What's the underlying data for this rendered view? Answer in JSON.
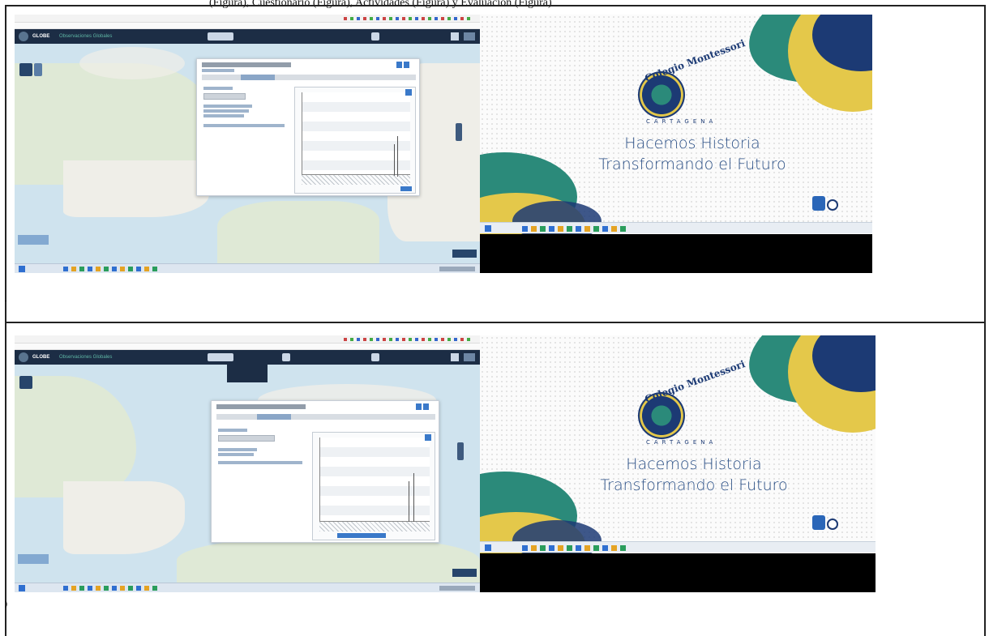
{
  "top_strip": {
    "text_1": "(Figura), Cuestionario (Figura), Actividades (Figura) y Evaluación (Figura)"
  },
  "app": {
    "name": "GLOBE",
    "tagline": "Observaciones Globales"
  },
  "slide": {
    "school_name": "Colegio Montessori",
    "city": "CARTAGENA",
    "line_1": "Hacemos Historia",
    "line_2": "Transformando el Futuro"
  },
  "row_markers": {
    "row_1": ".",
    "row_2": ")"
  },
  "icons": {
    "logo": "globe-logo-icon",
    "start": "windows-start-icon",
    "camera": "camera-icon",
    "speaker": "speaker-icon"
  },
  "colors": {
    "app_bar": "#1c2d45",
    "map_water": "#cfe3ee",
    "accent_blue": "#3a79c9",
    "slide_teal": "#2b8a7a",
    "slide_navy": "#1c3a74",
    "slide_yellow": "#e4c84a"
  }
}
